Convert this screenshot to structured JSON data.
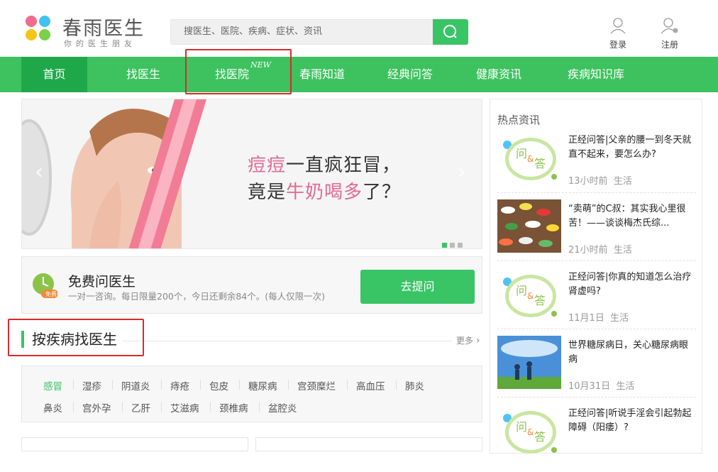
{
  "brand": {
    "name": "春雨医生",
    "slogan": "你的医生朋友",
    "colors": {
      "green": "#3dc25f",
      "pink": "#e36a95"
    }
  },
  "search": {
    "placeholder": "搜医生、医院、疾病、症状、资讯",
    "icon": "search-icon"
  },
  "header_links": [
    {
      "label": "登录",
      "icon": "user-icon"
    },
    {
      "label": "注册",
      "icon": "user-add-icon"
    }
  ],
  "nav": {
    "items": [
      {
        "label": "首页",
        "active": true
      },
      {
        "label": "找医生"
      },
      {
        "label": "找医院",
        "badge": "NEW"
      },
      {
        "label": "春雨知道"
      },
      {
        "label": "经典问答"
      },
      {
        "label": "健康资讯"
      },
      {
        "label": "疾病知识库"
      }
    ]
  },
  "banner": {
    "line1_pink": "痘痘",
    "line1_rest": "一直疯狂冒，",
    "line2_a": "竟是",
    "line2_pink": "牛奶喝多",
    "line2_b": "了？",
    "prev": "‹",
    "next": "›",
    "slides": 3,
    "active_slide": 1
  },
  "ask": {
    "badge": "免费",
    "title": "免费问医生",
    "desc": "一对一咨询。每日限量200个，今日还剩余84个。(每人仅限一次)",
    "button": "去提问"
  },
  "section": {
    "title": "按疾病找医生",
    "more": "更多"
  },
  "diseases": [
    "感冒",
    "湿疹",
    "阴道炎",
    "痔疮",
    "包皮",
    "糖尿病",
    "宫颈糜烂",
    "高血压",
    "肺炎",
    "鼻炎",
    "宫外孕",
    "乙肝",
    "艾滋病",
    "颈椎病",
    "盆腔炎"
  ],
  "sidebar": {
    "title": "热点资讯",
    "qa_icon": {
      "q": "问",
      "amp": "&",
      "a": "答"
    },
    "news": [
      {
        "title": "正经问答|父亲的腰一到冬天就直不起来，要怎么办?",
        "time": "13小时前",
        "category": "生活",
        "thumb": "qa"
      },
      {
        "title": "“卖萌”的C叔：其实我心里很苦！——谈谈梅杰氏综...",
        "time": "21小时前",
        "category": "生活",
        "thumb": "pills"
      },
      {
        "title": "正经问答|你真的知道怎么治疗肾虚吗?",
        "time": "11月1日",
        "category": "生活",
        "thumb": "qa"
      },
      {
        "title": "世界糖尿病日，关心糖尿病眼病",
        "time": "10月31日",
        "category": "生活",
        "thumb": "sky"
      },
      {
        "title": "正经问答|听说手淫会引起勃起障碍（阳痿）?",
        "time": "",
        "category": "",
        "thumb": "qa"
      }
    ]
  }
}
